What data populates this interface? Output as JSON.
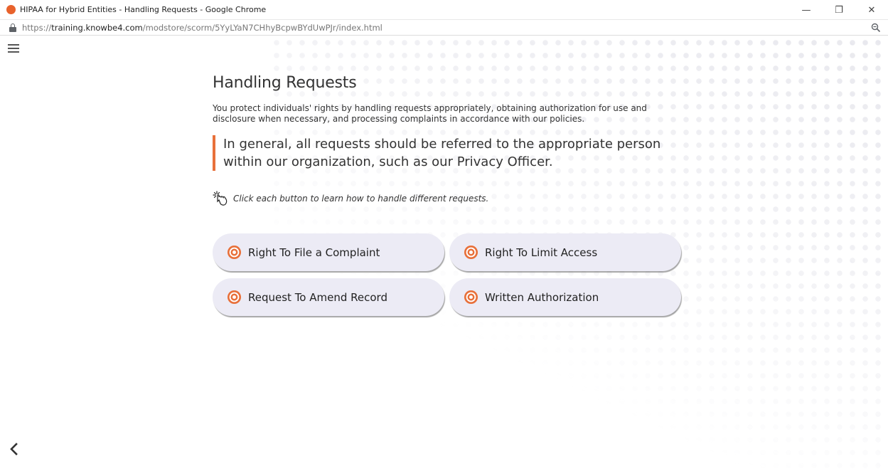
{
  "window": {
    "title": "HIPAA for Hybrid Entities - Handling Requests - Google Chrome",
    "minimize_glyph": "—",
    "restore_glyph": "❐",
    "close_glyph": "✕"
  },
  "address_bar": {
    "scheme": "https://",
    "host": "training.knowbe4.com",
    "path": "/modstore/scorm/5YyLYaN7CHhyBcpwBYdUwPJr/index.html"
  },
  "page": {
    "heading": "Handling Requests",
    "intro": "You protect individuals' rights by handling requests appropriately, obtaining authorization for use and disclosure when necessary, and processing complaints in accordance with our policies.",
    "callout": "In general, all requests should be referred to the appropriate person within our organization, such as our Privacy Officer.",
    "hint": "Click each button to learn how to handle different requests.",
    "buttons": [
      {
        "label": "Right To File a Complaint"
      },
      {
        "label": "Right To Limit Access"
      },
      {
        "label": "Request To Amend Record"
      },
      {
        "label": "Written Authorization"
      }
    ]
  },
  "colors": {
    "accent": "#e8703a",
    "button_bg": "#ecebf5",
    "favicon": "#e8622c"
  },
  "icons": {
    "menu": "hamburger-menu-icon",
    "lock": "lock-icon",
    "zoom": "zoom-icon",
    "click": "click-hand-icon",
    "button": "target-icon",
    "back": "chevron-left-icon"
  }
}
